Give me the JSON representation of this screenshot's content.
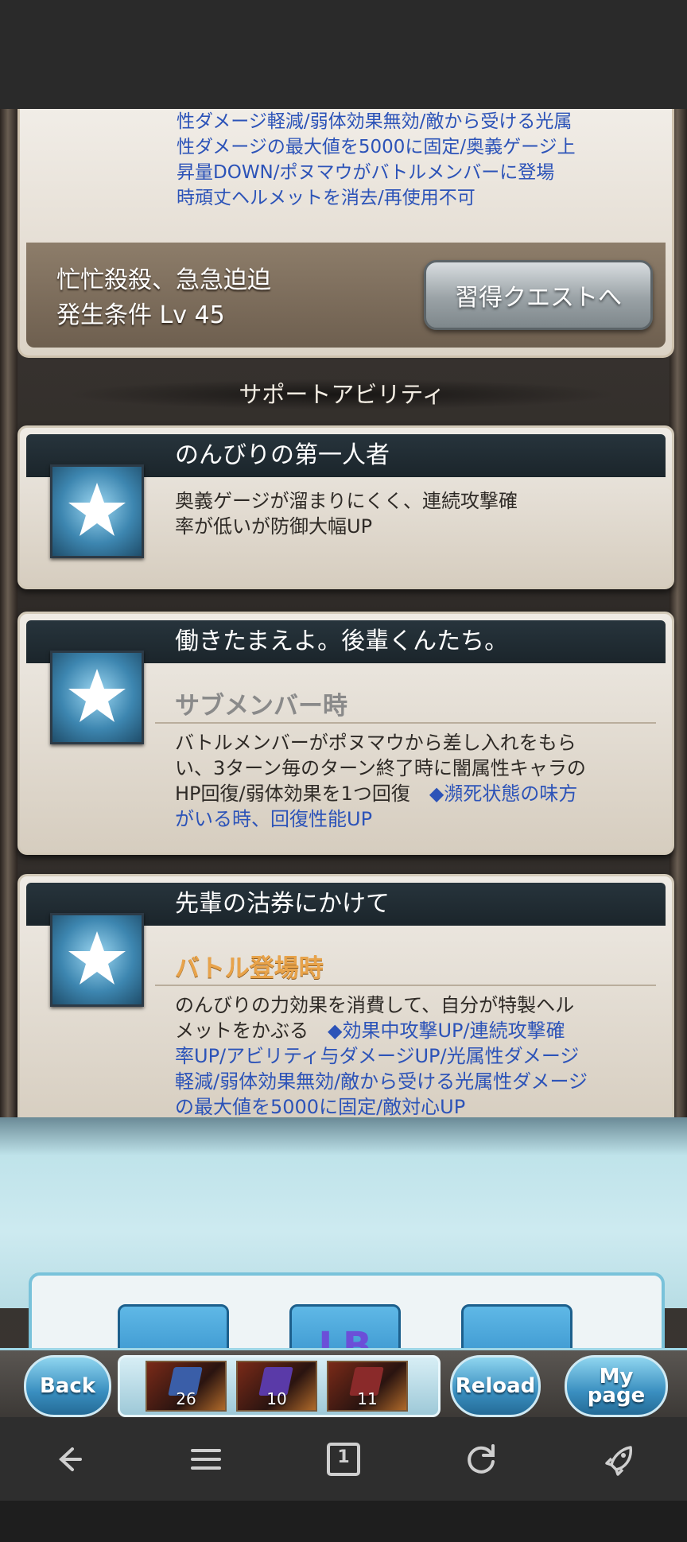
{
  "top_card": {
    "description_lines": [
      "性ダメージ軽減/弱体効果無効/敵から受ける光属",
      "性ダメージの最大値を5000に固定/奥義ゲージ上",
      "昇量DOWN/ポヌマウがバトルメンバーに登場",
      "時頑丈ヘルメットを消去/再使用不可"
    ],
    "footer_line1": "忙忙殺殺、急急迫迫",
    "footer_line2": "発生条件 Lv 45",
    "learn_button": "習得クエストへ"
  },
  "section_title": "サポートアビリティ",
  "skills": [
    {
      "name": "のんびりの第一人者",
      "text_lines": [
        "奥義ゲージが溜まりにくく、連続攻撃確",
        "率が低いが防御大幅UP"
      ]
    },
    {
      "name": "働きたまえよ。後輩くんたち。",
      "subheading": "サブメンバー時",
      "text_lines": [
        "バトルメンバーがポヌマウから差し入れをもら",
        "い、3ターン毎のターン終了時に闇属性キャラの"
      ],
      "mixed_line_black": "HP回復/弱体効果を1つ回復　",
      "mixed_line_blue": "◆瀕死状態の味方",
      "blue_lines": [
        "がいる時、回復性能UP"
      ]
    },
    {
      "name": "先輩の沽券にかけて",
      "subheading": "バトル登場時",
      "text_lines": [
        "のんびりの力効果を消費して、自分が特製ヘル"
      ],
      "mixed_line_black": "メットをかぶる　",
      "mixed_line_blue": "◆効果中攻撃UP/連続攻撃確",
      "blue_lines": [
        "率UP/アビリティ与ダメージUP/光属性ダメージ",
        "軽減/弱体効果無効/敵から受ける光属性ダメージ",
        "の最大値を5000に固定/敵対心UP"
      ]
    }
  ],
  "lower_tiles": [
    "",
    "LB",
    ""
  ],
  "toolbar": {
    "back_label": "Back",
    "items": [
      {
        "count": "26",
        "color": "#3a5ea8"
      },
      {
        "count": "10",
        "color": "#5a3aa8"
      },
      {
        "count": "11",
        "color": "#8a2a2a"
      }
    ],
    "reload_label": "Reload",
    "mypage_label_1": "My",
    "mypage_label_2": "page"
  },
  "navbar": {
    "tab_count": "1"
  }
}
